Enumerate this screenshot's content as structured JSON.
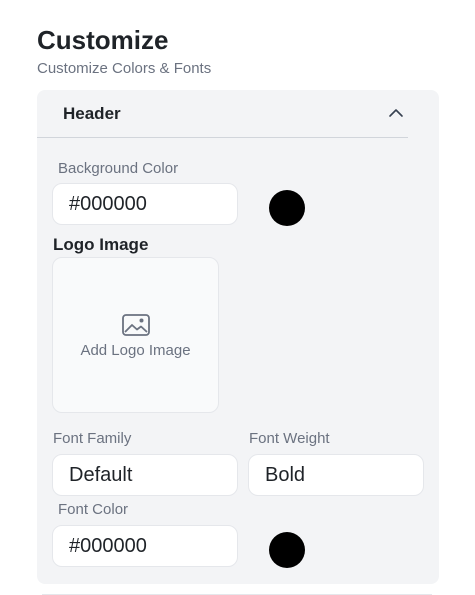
{
  "page": {
    "title": "Customize",
    "subtitle": "Customize Colors & Fonts"
  },
  "section": {
    "title": "Header",
    "toggle_icon": "chevron-up-icon",
    "background_color": {
      "label": "Background Color",
      "value": "#000000",
      "swatch": "#000000"
    },
    "logo": {
      "label": "Logo Image",
      "upload_text": "Add Logo Image",
      "icon": "image-icon"
    },
    "font_family": {
      "label": "Font Family",
      "value": "Default"
    },
    "font_weight": {
      "label": "Font Weight",
      "value": "Bold"
    },
    "font_color": {
      "label": "Font Color",
      "value": "#000000",
      "swatch": "#000000"
    }
  }
}
